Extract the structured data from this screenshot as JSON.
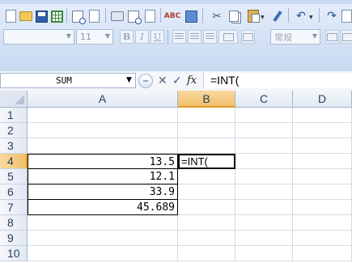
{
  "formula_bar": {
    "name_box": "SUM",
    "cancel_glyph": "✕",
    "enter_glyph": "✓",
    "fx_label": "fx",
    "formula": "=INT("
  },
  "toolbar": {
    "font_size": "11",
    "bold": "B",
    "italic": "I",
    "underline": "U",
    "number_format": "常规"
  },
  "columns": [
    "A",
    "B",
    "C",
    "D"
  ],
  "rows": [
    {
      "num": "1",
      "a": "",
      "b": ""
    },
    {
      "num": "2",
      "a": "",
      "b": ""
    },
    {
      "num": "3",
      "a": "",
      "b": ""
    },
    {
      "num": "4",
      "a": "13.5",
      "b": "=INT("
    },
    {
      "num": "5",
      "a": "12.1",
      "b": ""
    },
    {
      "num": "6",
      "a": "33.9",
      "b": ""
    },
    {
      "num": "7",
      "a": "45.689",
      "b": ""
    },
    {
      "num": "8",
      "a": "",
      "b": ""
    },
    {
      "num": "9",
      "a": "",
      "b": ""
    },
    {
      "num": "10",
      "a": "",
      "b": ""
    }
  ],
  "active_cell": "B4",
  "colors": {
    "ribbon": "#d5e2f5",
    "header_active": "#f1c06c",
    "grid_line": "#d4dce8"
  }
}
